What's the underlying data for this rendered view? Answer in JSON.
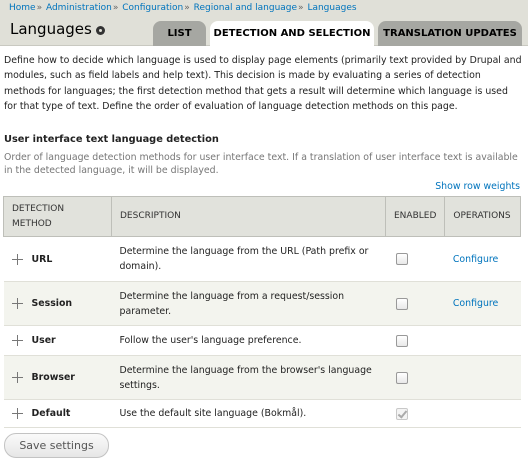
{
  "breadcrumb": {
    "items": [
      "Home",
      "Administration",
      "Configuration",
      "Regional and language",
      "Languages"
    ],
    "separator": "»"
  },
  "header": {
    "title": "Languages"
  },
  "tabs": [
    {
      "label": "LIST",
      "active": false
    },
    {
      "label": "DETECTION AND SELECTION",
      "active": true
    },
    {
      "label": "TRANSLATION UPDATES",
      "active": false
    }
  ],
  "intro": "Define how to decide which language is used to display page elements (primarily text provided by Drupal and modules, such as field labels and help text). This decision is made by evaluating a series of detection methods for languages; the first detection method that gets a result will determine which language is used for that type of text. Define the order of evaluation of language detection methods on this page.",
  "section": {
    "title": "User interface text language detection",
    "description": "Order of language detection methods for user interface text. If a translation of user interface text is available in the detected language, it will be displayed.",
    "show_row_weights": "Show row weights"
  },
  "table": {
    "headers": [
      "DETECTION METHOD",
      "DESCRIPTION",
      "ENABLED",
      "OPERATIONS"
    ],
    "rows": [
      {
        "method": "URL",
        "description": "Determine the language from the URL (Path prefix or domain).",
        "enabled": false,
        "operation": "Configure"
      },
      {
        "method": "Session",
        "description": "Determine the language from a request/session parameter.",
        "enabled": false,
        "operation": "Configure"
      },
      {
        "method": "User",
        "description": "Follow the user's language preference.",
        "enabled": false,
        "operation": ""
      },
      {
        "method": "Browser",
        "description": "Determine the language from the browser's language settings.",
        "enabled": false,
        "operation": ""
      },
      {
        "method": "Default",
        "description": "Use the default site language (Bokmål).",
        "enabled": true,
        "enabled_disabled": true,
        "operation": ""
      }
    ]
  },
  "actions": {
    "save_label": "Save settings"
  },
  "colors": {
    "link": "#0074bd",
    "header_bg": "#e0e0d8",
    "tab_bg": "#a6a7a2",
    "table_header_bg": "#e1e2dc",
    "even_row_bg": "#f3f4ee"
  },
  "icons": {
    "shortcut": "shortcut-star-icon",
    "drag": "drag-handle-icon"
  }
}
